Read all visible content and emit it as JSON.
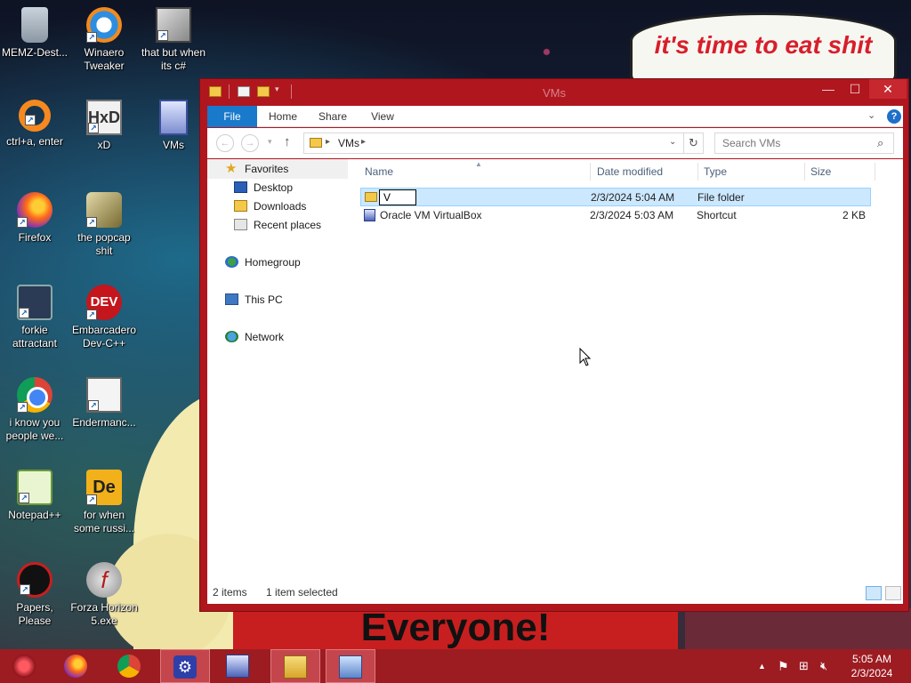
{
  "wallpaper": {
    "banner_text": "it's time to eat shit",
    "bottom_sign": "Everyone!"
  },
  "desktop_icons": [
    {
      "label": "MEMZ-Dest...",
      "icon": "recycle-bin-icon"
    },
    {
      "label": "Winaero Tweaker",
      "icon": "winaero-icon"
    },
    {
      "label": "that but when its c#",
      "icon": "windows-stack-icon"
    },
    {
      "label": "ctrl+a, enter",
      "icon": "orange-ring-icon"
    },
    {
      "label": "xD",
      "icon": "hxd-icon"
    },
    {
      "label": "VMs",
      "icon": "virtualbox-folder-icon"
    },
    {
      "label": "Firefox",
      "icon": "firefox-icon"
    },
    {
      "label": "the popcap shit",
      "icon": "popcap-icon"
    },
    {
      "label": "forkie attractant",
      "icon": "gear-monitor-icon"
    },
    {
      "label": "Embarcadero Dev-C++",
      "icon": "devcpp-icon"
    },
    {
      "label": "i know you people we...",
      "icon": "chrome-icon"
    },
    {
      "label": "Endermanc...",
      "icon": "window-app-icon"
    },
    {
      "label": "Notepad++",
      "icon": "notepadpp-icon"
    },
    {
      "label": "for when some russi...",
      "icon": "de-icon"
    },
    {
      "label": "Papers, Please",
      "icon": "papers-please-icon"
    },
    {
      "label": "Forza Horizon 5.exe",
      "icon": "flash-icon"
    }
  ],
  "window": {
    "title": "VMs",
    "controls": {
      "minimize": "—",
      "maximize": "☐",
      "close": "✕"
    },
    "ribbon_tabs": [
      "File",
      "Home",
      "Share",
      "View"
    ],
    "help": "?",
    "address": {
      "path": "VMs"
    },
    "search": {
      "placeholder": "Search VMs"
    },
    "nav_pane": {
      "favorites": "Favorites",
      "favorites_items": [
        "Desktop",
        "Downloads",
        "Recent places"
      ],
      "homegroup": "Homegroup",
      "this_pc": "This PC",
      "network": "Network"
    },
    "columns": {
      "name": "Name",
      "date": "Date modified",
      "type": "Type",
      "size": "Size"
    },
    "files": [
      {
        "name": "",
        "rename_value": "V",
        "date": "2/3/2024 5:04 AM",
        "type": "File folder",
        "size": "",
        "selected": true
      },
      {
        "name": "Oracle VM VirtualBox",
        "rename_value": "",
        "date": "2/3/2024 5:03 AM",
        "type": "Shortcut",
        "size": "2 KB",
        "selected": false
      }
    ],
    "status": {
      "item_count": "2 items",
      "selected": "1 item selected"
    }
  },
  "taskbar": {
    "clock_time": "5:05 AM",
    "clock_date": "2/3/2024"
  },
  "colors": {
    "window_frame": "#b0161e",
    "taskbar": "#9c1c22",
    "file_tab": "#1979ca",
    "selection": "#cce8ff"
  }
}
